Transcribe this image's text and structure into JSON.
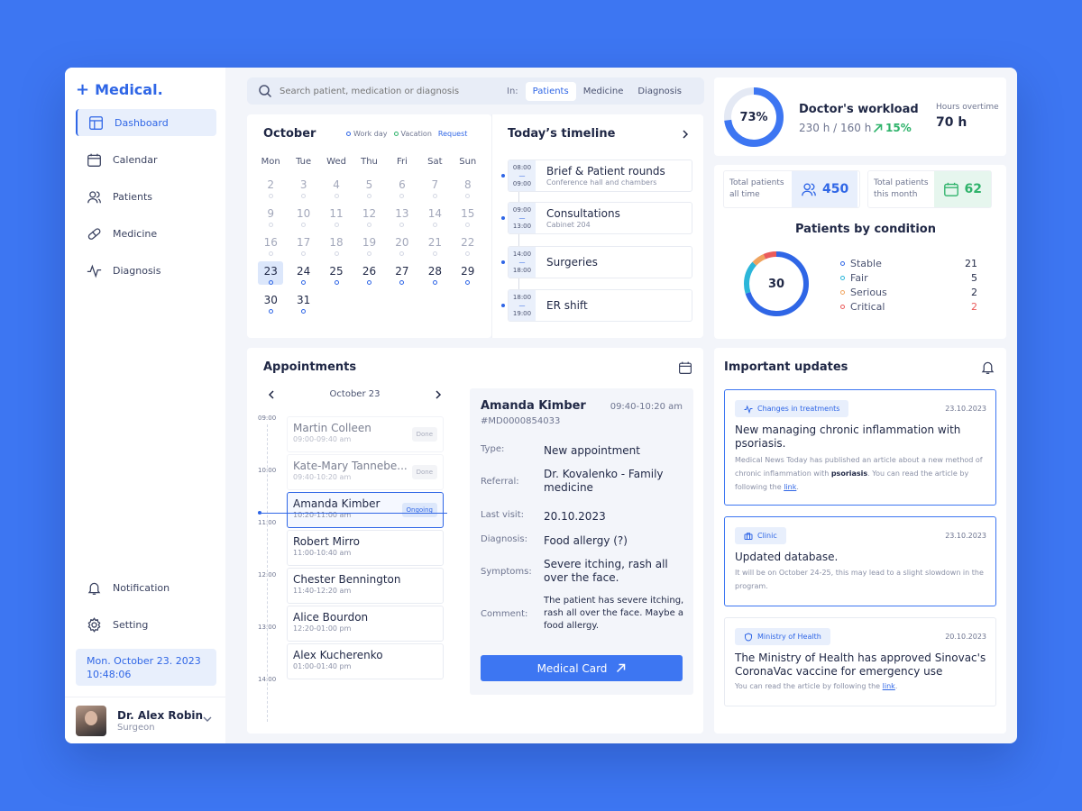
{
  "app": {
    "logo": "Medical.",
    "logo_plus": "+"
  },
  "sidebar": {
    "items": [
      {
        "label": "Dashboard",
        "icon": "dashboard-icon",
        "active": true
      },
      {
        "label": "Calendar",
        "icon": "calendar-icon"
      },
      {
        "label": "Patients",
        "icon": "patients-icon"
      },
      {
        "label": "Medicine",
        "icon": "pill-icon"
      },
      {
        "label": "Diagnosis",
        "icon": "pulse-icon"
      }
    ],
    "bottom_items": [
      {
        "label": "Notification",
        "icon": "bell-icon"
      },
      {
        "label": "Setting",
        "icon": "gear-icon"
      }
    ],
    "date": "Mon. October 23. 2023",
    "time": "10:48:06",
    "user": {
      "name": "Dr. Alex Robin",
      "role": "Surgeon"
    }
  },
  "search": {
    "placeholder": "Search patient, medication or diagnosis",
    "in_label": "In:",
    "filters": [
      "Patients",
      "Medicine",
      "Diagnosis"
    ],
    "active_filter": "Patients"
  },
  "calendar": {
    "title": "October",
    "legend": {
      "work": "Work day",
      "vacation": "Vacation",
      "request": "Request"
    },
    "weekdays": [
      "Mon",
      "Tue",
      "Wed",
      "Thu",
      "Fri",
      "Sat",
      "Sun"
    ],
    "days": [
      2,
      3,
      4,
      5,
      6,
      7,
      8,
      9,
      10,
      11,
      12,
      13,
      14,
      15,
      16,
      17,
      18,
      19,
      20,
      21,
      22,
      23,
      24,
      25,
      26,
      27,
      28,
      29,
      30,
      31
    ],
    "today": 23
  },
  "timeline": {
    "title": "Today’s timeline",
    "items": [
      {
        "start": "08:00",
        "end": "09:00",
        "name": "Brief & Patient rounds",
        "sub": "Conference hall and chambers"
      },
      {
        "start": "09:00",
        "end": "13:00",
        "name": "Consultations",
        "sub": "Cabinet 204"
      },
      {
        "start": "14:00",
        "end": "18:00",
        "name": "Surgeries",
        "sub": ""
      },
      {
        "start": "18:00",
        "end": "19:00",
        "name": "ER shift",
        "sub": ""
      }
    ]
  },
  "workload": {
    "percent": "73%",
    "percent_value": 73,
    "title": "Doctor's workload",
    "hours": "230 h / 160 h",
    "trend": "15%",
    "overtime_label": "Hours overtime",
    "overtime": "70 h"
  },
  "stats": {
    "total_all_label": "Total patients all time",
    "total_all": "450",
    "total_month_label": "Total patients this month",
    "total_month": "62"
  },
  "condition": {
    "title": "Patients by condition",
    "total": "30",
    "rows": [
      {
        "label": "Stable",
        "value": "21",
        "color": "#2f66e6"
      },
      {
        "label": "Fair",
        "value": "5",
        "color": "#2bb6d9"
      },
      {
        "label": "Serious",
        "value": "2",
        "color": "#f0a35e"
      },
      {
        "label": "Critical",
        "value": "2",
        "color": "#ea5b5b"
      }
    ]
  },
  "appointments": {
    "title": "Appointments",
    "date": "October 23",
    "hours": [
      "09:00",
      "10:00",
      "11:00",
      "12:00",
      "13:00",
      "14:00"
    ],
    "slots": [
      {
        "name": "Martin Colleen",
        "time": "09:00-09:40 am",
        "status": "Done"
      },
      {
        "name": "Kate-Mary Tannebe...",
        "time": "09:40-10:20 am",
        "status": "Done"
      },
      {
        "name": "Amanda Kimber",
        "time": "10:20-11:00 am",
        "status": "Ongoing"
      },
      {
        "name": "Robert Mirro",
        "time": "11:00-10:40 am",
        "status": ""
      },
      {
        "name": "Chester Bennington",
        "time": "11:40-12:20 am",
        "status": ""
      },
      {
        "name": "Alice Bourdon",
        "time": "12:20-01:00 pm",
        "status": ""
      },
      {
        "name": "Alex Kucherenko",
        "time": "01:00-01:40 pm",
        "status": ""
      }
    ],
    "detail": {
      "name": "Amanda Kimber",
      "time": "09:40-10:20 am",
      "id": "#MD0000854033",
      "type_label": "Type:",
      "type": "New appointment",
      "referral_label": "Referral:",
      "referral": "Dr. Kovalenko -  Family medicine",
      "last_visit_label": "Last visit:",
      "last_visit": "20.10.2023",
      "diagnosis_label": "Diagnosis:",
      "diagnosis": "Food allergy (?)",
      "symptoms_label": "Symptoms:",
      "symptoms": "Severe itching, rash all over the face.",
      "comment_label": "Comment:",
      "comment": "The patient has severe itching, rash all over the face. Maybe a food allergy.",
      "button": "Medical Card"
    }
  },
  "updates": {
    "title": "Important updates",
    "items": [
      {
        "tag": "Changes in treatments",
        "date": "23.10.2023",
        "headline": "New managing chronic inflammation with psoriasis.",
        "body_1": "Medical News Today has published an article about a new method of chronic inflammation with ",
        "body_bold": "psoriasis",
        "body_2": ". You can read the article by following the ",
        "link": "link",
        "body_end": "."
      },
      {
        "tag": "Clinic",
        "date": "23.10.2023",
        "headline": "Updated database.",
        "body": "It will be on October 24-25, this may lead to a slight slowdown in the program."
      },
      {
        "tag": "Ministry of Health",
        "date": "20.10.2023",
        "headline": "The Ministry of Health has approved Sinovac's CoronaVac vaccine for emergency use",
        "body_1": "You can read the article by following the ",
        "link": "link",
        "body_end": "."
      }
    ]
  }
}
